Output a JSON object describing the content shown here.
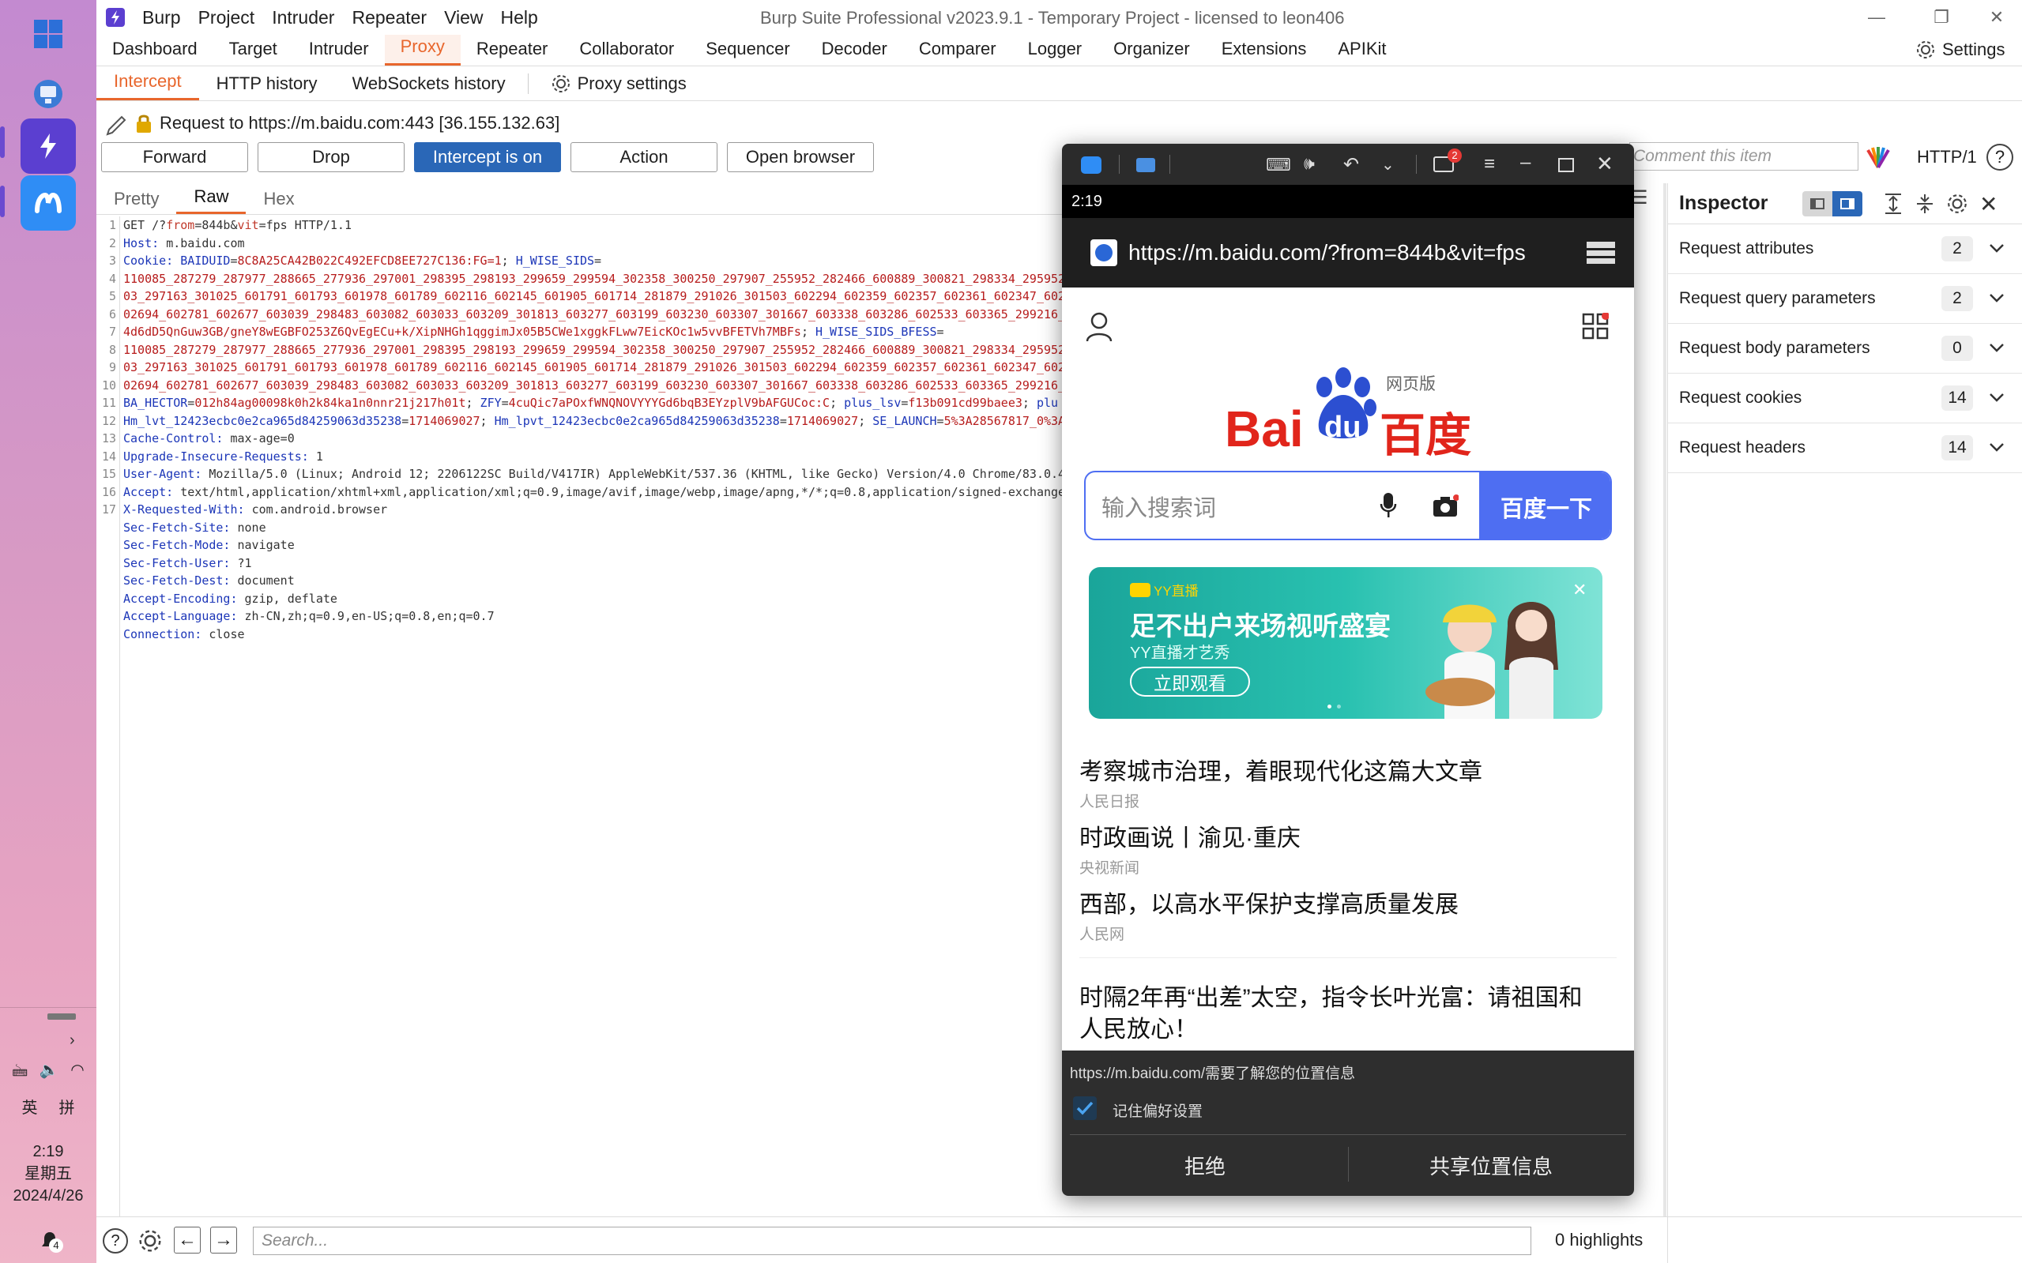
{
  "window": {
    "title": "Burp Suite Professional v2023.9.1 - Temporary Project - licensed to leon406",
    "menu": [
      "Burp",
      "Project",
      "Intruder",
      "Repeater",
      "View",
      "Help"
    ]
  },
  "main_tabs": [
    "Dashboard",
    "Target",
    "Intruder",
    "Proxy",
    "Repeater",
    "Collaborator",
    "Sequencer",
    "Decoder",
    "Comparer",
    "Logger",
    "Organizer",
    "Extensions",
    "APIKit"
  ],
  "main_tabs_active": "Proxy",
  "settings_label": "Settings",
  "sub_tabs": [
    "Intercept",
    "HTTP history",
    "WebSockets history"
  ],
  "proxy_settings_label": "Proxy settings",
  "request_target": "Request to https://m.baidu.com:443  [36.155.132.63]",
  "buttons": {
    "forward": "Forward",
    "drop": "Drop",
    "intercept": "Intercept is on",
    "action": "Action",
    "open_browser": "Open browser"
  },
  "comment_placeholder": "Comment this item",
  "http_version": "HTTP/1",
  "editor_tabs": [
    "Pretty",
    "Raw",
    "Hex"
  ],
  "request_lines": [
    {
      "n": "1",
      "parts": [
        [
          "hv",
          "GET /?"
        ],
        [
          "pk",
          "from"
        ],
        [
          "hv",
          "=844b&"
        ],
        [
          "pk",
          "vit"
        ],
        [
          "hv",
          "=fps HTTP/1.1"
        ]
      ]
    },
    {
      "n": "2",
      "parts": [
        [
          "hk",
          "Host: "
        ],
        [
          "hv",
          "m.baidu.com"
        ]
      ]
    },
    {
      "n": "3",
      "parts": [
        [
          "hk",
          "Cookie: "
        ],
        [
          "cw",
          "BAIDUID"
        ],
        [
          "hv",
          "="
        ],
        [
          "cv",
          "8C8A25CA42B022C492EFCD8EE727C136:FG=1"
        ],
        [
          "hv",
          "; "
        ],
        [
          "cw",
          "H_WISE_SIDS"
        ],
        [
          "hv",
          "="
        ]
      ]
    },
    {
      "n": "",
      "parts": [
        [
          "cv",
          "110085_287279_287977_288665_277936_297001_298395_298193_299659_299594_302358_300250_297907_255952_282466_600889_300821_298334_295952"
        ]
      ]
    },
    {
      "n": "",
      "parts": [
        [
          "cv",
          "03_297163_301025_601791_601793_601978_601789_602116_602145_601905_601714_281879_291026_301503_602294_602359_602357_602361_602347_602"
        ]
      ]
    },
    {
      "n": "",
      "parts": [
        [
          "cv",
          "02694_602781_602677_603039_298483_603082_603033_603209_301813_603277_603199_603230_603307_301667_603338_603286_602533_603365_299216_"
        ]
      ]
    },
    {
      "n": "",
      "parts": [
        [
          "cv",
          "4d6dD5QnGuw3GB/gneY8wEGBFO253Z6QvEgECu+k/XipNHGh1qggimJx05B5CWe1xggkFLww7EicKOc1w5vvBFETVh7MBFs"
        ],
        [
          "hv",
          "; "
        ],
        [
          "cw",
          "H_WISE_SIDS_BFESS"
        ],
        [
          "hv",
          "="
        ]
      ]
    },
    {
      "n": "",
      "parts": [
        [
          "cv",
          "110085_287279_287977_288665_277936_297001_298395_298193_299659_299594_302358_300250_297907_255952_282466_600889_300821_298334_295952"
        ]
      ]
    },
    {
      "n": "",
      "parts": [
        [
          "cv",
          "03_297163_301025_601791_601793_601978_601789_602116_602145_601905_601714_281879_291026_301503_602294_602359_602357_602361_602347_602"
        ]
      ]
    },
    {
      "n": "",
      "parts": [
        [
          "cv",
          "02694_602781_602677_603039_298483_603082_603033_603209_301813_603277_603199_603230_603307_301667_603338_603286_602533_603365_299216_"
        ]
      ]
    },
    {
      "n": "",
      "parts": [
        [
          "cw",
          "BA_HECTOR"
        ],
        [
          "hv",
          "="
        ],
        [
          "cv",
          "012h84ag00098k0h2k84ka1n0nnr21j217h01t"
        ],
        [
          "hv",
          "; "
        ],
        [
          "cw",
          "ZFY"
        ],
        [
          "hv",
          "="
        ],
        [
          "cv",
          "4cuQic7aPOxfWNQNOVYYYGd6bqB3EYzplV9bAFGUCoc:C"
        ],
        [
          "hv",
          "; "
        ],
        [
          "cw",
          "plus_lsv"
        ],
        [
          "hv",
          "="
        ],
        [
          "cv",
          "f13b091cd99baee3"
        ],
        [
          "hv",
          "; "
        ],
        [
          "cw",
          "plu"
        ]
      ]
    },
    {
      "n": "",
      "parts": [
        [
          "cw",
          "Hm_lvt_12423ecbc0e2ca965d84259063d35238"
        ],
        [
          "hv",
          "="
        ],
        [
          "cv",
          "1714069027"
        ],
        [
          "hv",
          "; "
        ],
        [
          "cw",
          "Hm_lpvt_12423ecbc0e2ca965d84259063d35238"
        ],
        [
          "hv",
          "="
        ],
        [
          "cv",
          "1714069027"
        ],
        [
          "hv",
          "; "
        ],
        [
          "cw",
          "SE_LAUNCH"
        ],
        [
          "hv",
          "="
        ],
        [
          "cv",
          "5%3A28567817_0%3A"
        ]
      ]
    },
    {
      "n": "4",
      "parts": [
        [
          "hk",
          "Cache-Control: "
        ],
        [
          "hv",
          "max-age=0"
        ]
      ]
    },
    {
      "n": "5",
      "parts": [
        [
          "hk",
          "Upgrade-Insecure-Requests: "
        ],
        [
          "hv",
          "1"
        ]
      ]
    },
    {
      "n": "6",
      "parts": [
        [
          "hk",
          "User-Agent: "
        ],
        [
          "hv",
          "Mozilla/5.0 (Linux; Android 12; 2206122SC Build/V417IR) AppleWebKit/537.36 (KHTML, like Gecko) Version/4.0 Chrome/83.0.4"
        ]
      ]
    },
    {
      "n": "7",
      "parts": [
        [
          "hk",
          "Accept: "
        ],
        [
          "hv",
          "text/html,application/xhtml+xml,application/xml;q=0.9,image/avif,image/webp,image/apng,*/*;q=0.8,application/signed-exchange"
        ]
      ]
    },
    {
      "n": "8",
      "parts": [
        [
          "hk",
          "X-Requested-With: "
        ],
        [
          "hv",
          "com.android.browser"
        ]
      ]
    },
    {
      "n": "9",
      "parts": [
        [
          "hk",
          "Sec-Fetch-Site: "
        ],
        [
          "hv",
          "none"
        ]
      ]
    },
    {
      "n": "10",
      "parts": [
        [
          "hk",
          "Sec-Fetch-Mode: "
        ],
        [
          "hv",
          "navigate"
        ]
      ]
    },
    {
      "n": "11",
      "parts": [
        [
          "hk",
          "Sec-Fetch-User: "
        ],
        [
          "hv",
          "?1"
        ]
      ]
    },
    {
      "n": "12",
      "parts": [
        [
          "hk",
          "Sec-Fetch-Dest: "
        ],
        [
          "hv",
          "document"
        ]
      ]
    },
    {
      "n": "13",
      "parts": [
        [
          "hk",
          "Accept-Encoding: "
        ],
        [
          "hv",
          "gzip, deflate"
        ]
      ]
    },
    {
      "n": "14",
      "parts": [
        [
          "hk",
          "Accept-Language: "
        ],
        [
          "hv",
          "zh-CN,zh;q=0.9,en-US;q=0.8,en;q=0.7"
        ]
      ]
    },
    {
      "n": "15",
      "parts": [
        [
          "hk",
          "Connection: "
        ],
        [
          "hv",
          "close"
        ]
      ]
    },
    {
      "n": "16",
      "parts": []
    },
    {
      "n": "17",
      "parts": []
    }
  ],
  "inspector": {
    "title": "Inspector",
    "rows": [
      {
        "label": "Request attributes",
        "count": "2"
      },
      {
        "label": "Request query parameters",
        "count": "2"
      },
      {
        "label": "Request body parameters",
        "count": "0"
      },
      {
        "label": "Request cookies",
        "count": "14"
      },
      {
        "label": "Request headers",
        "count": "14"
      }
    ]
  },
  "bottom": {
    "search_placeholder": "Search...",
    "highlights": "0 highlights"
  },
  "phone": {
    "time": "2:19",
    "notify_count": "2",
    "url": "https://m.baidu.com/?from=844b&vit=fps",
    "logo_bai": "Bai",
    "logo_du": "du",
    "logo_cn": "百度",
    "logo_tag": "网页版",
    "search_placeholder": "输入搜索词",
    "search_button": "百度一下",
    "banner": {
      "brand": "YY直播",
      "headline": "足不出户来场视听盛宴",
      "sub": "YY直播才艺秀",
      "cta": "立即观看"
    },
    "news": [
      {
        "title": "考察城市治理，着眼现代化这篇大文章",
        "source": "人民日报"
      },
      {
        "title": "时政画说丨渝见·重庆",
        "source": "央视新闻"
      },
      {
        "title": "西部，以高水平保护支撑高质量发展",
        "source": "人民网"
      }
    ],
    "news_last_line1": "时隔2年再“出差”太空，指令长叶光富：请祖国和",
    "news_last_line2": "人民放心！",
    "dialog": {
      "message": "https://m.baidu.com/需要了解您的位置信息",
      "remember": "记住偏好设置",
      "deny": "拒绝",
      "allow": "共享位置信息"
    }
  },
  "taskbar": {
    "ime1": "英",
    "ime2": "拼",
    "time": "2:19",
    "weekday": "星期五",
    "date": "2024/4/26",
    "notif_count": "4"
  }
}
